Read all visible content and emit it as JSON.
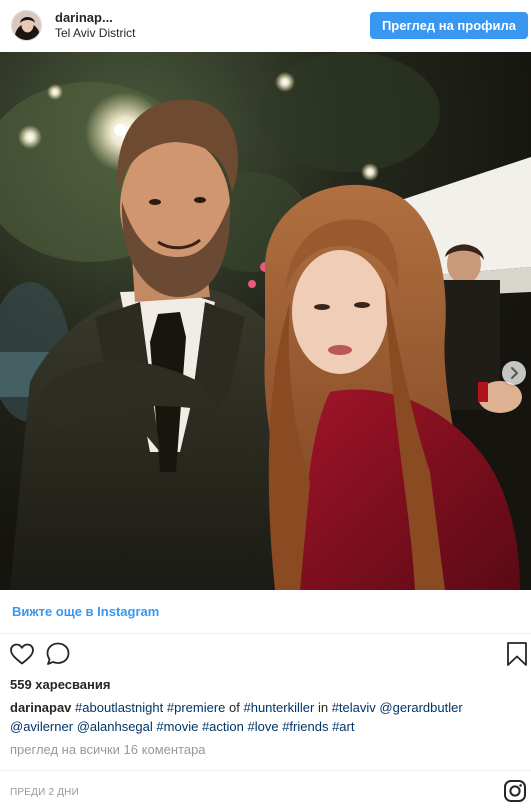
{
  "header": {
    "username": "darinap...",
    "location": "Tel Aviv District",
    "profile_button": "Преглед на профила"
  },
  "see_more": "Вижте още в Instagram",
  "likes": "559 харесвания",
  "caption": {
    "user": "darinapav",
    "t1": "#aboutlastnight",
    "t2": "#premiere",
    "w1": "of",
    "t3": "#hunterkiller",
    "w2": "in",
    "t4": "#telaviv",
    "t5": "@gerardbutler",
    "t6": "@avilerner",
    "t7": "@alanhsegal",
    "t8": "#movie",
    "t9": "#action",
    "t10": "#love",
    "t11": "#friends",
    "t12": "#art"
  },
  "comments_link": "преглед на всички 16 коментара",
  "timestamp": "ПРЕДИ 2 ДНИ",
  "icons": {
    "like": "heart-icon",
    "comment": "comment-icon",
    "save": "bookmark-icon",
    "brand": "instagram-icon",
    "carousel_next": "chevron-right-icon"
  },
  "colors": {
    "accent": "#3897f0",
    "hashtag": "#003569",
    "muted": "#999999"
  }
}
